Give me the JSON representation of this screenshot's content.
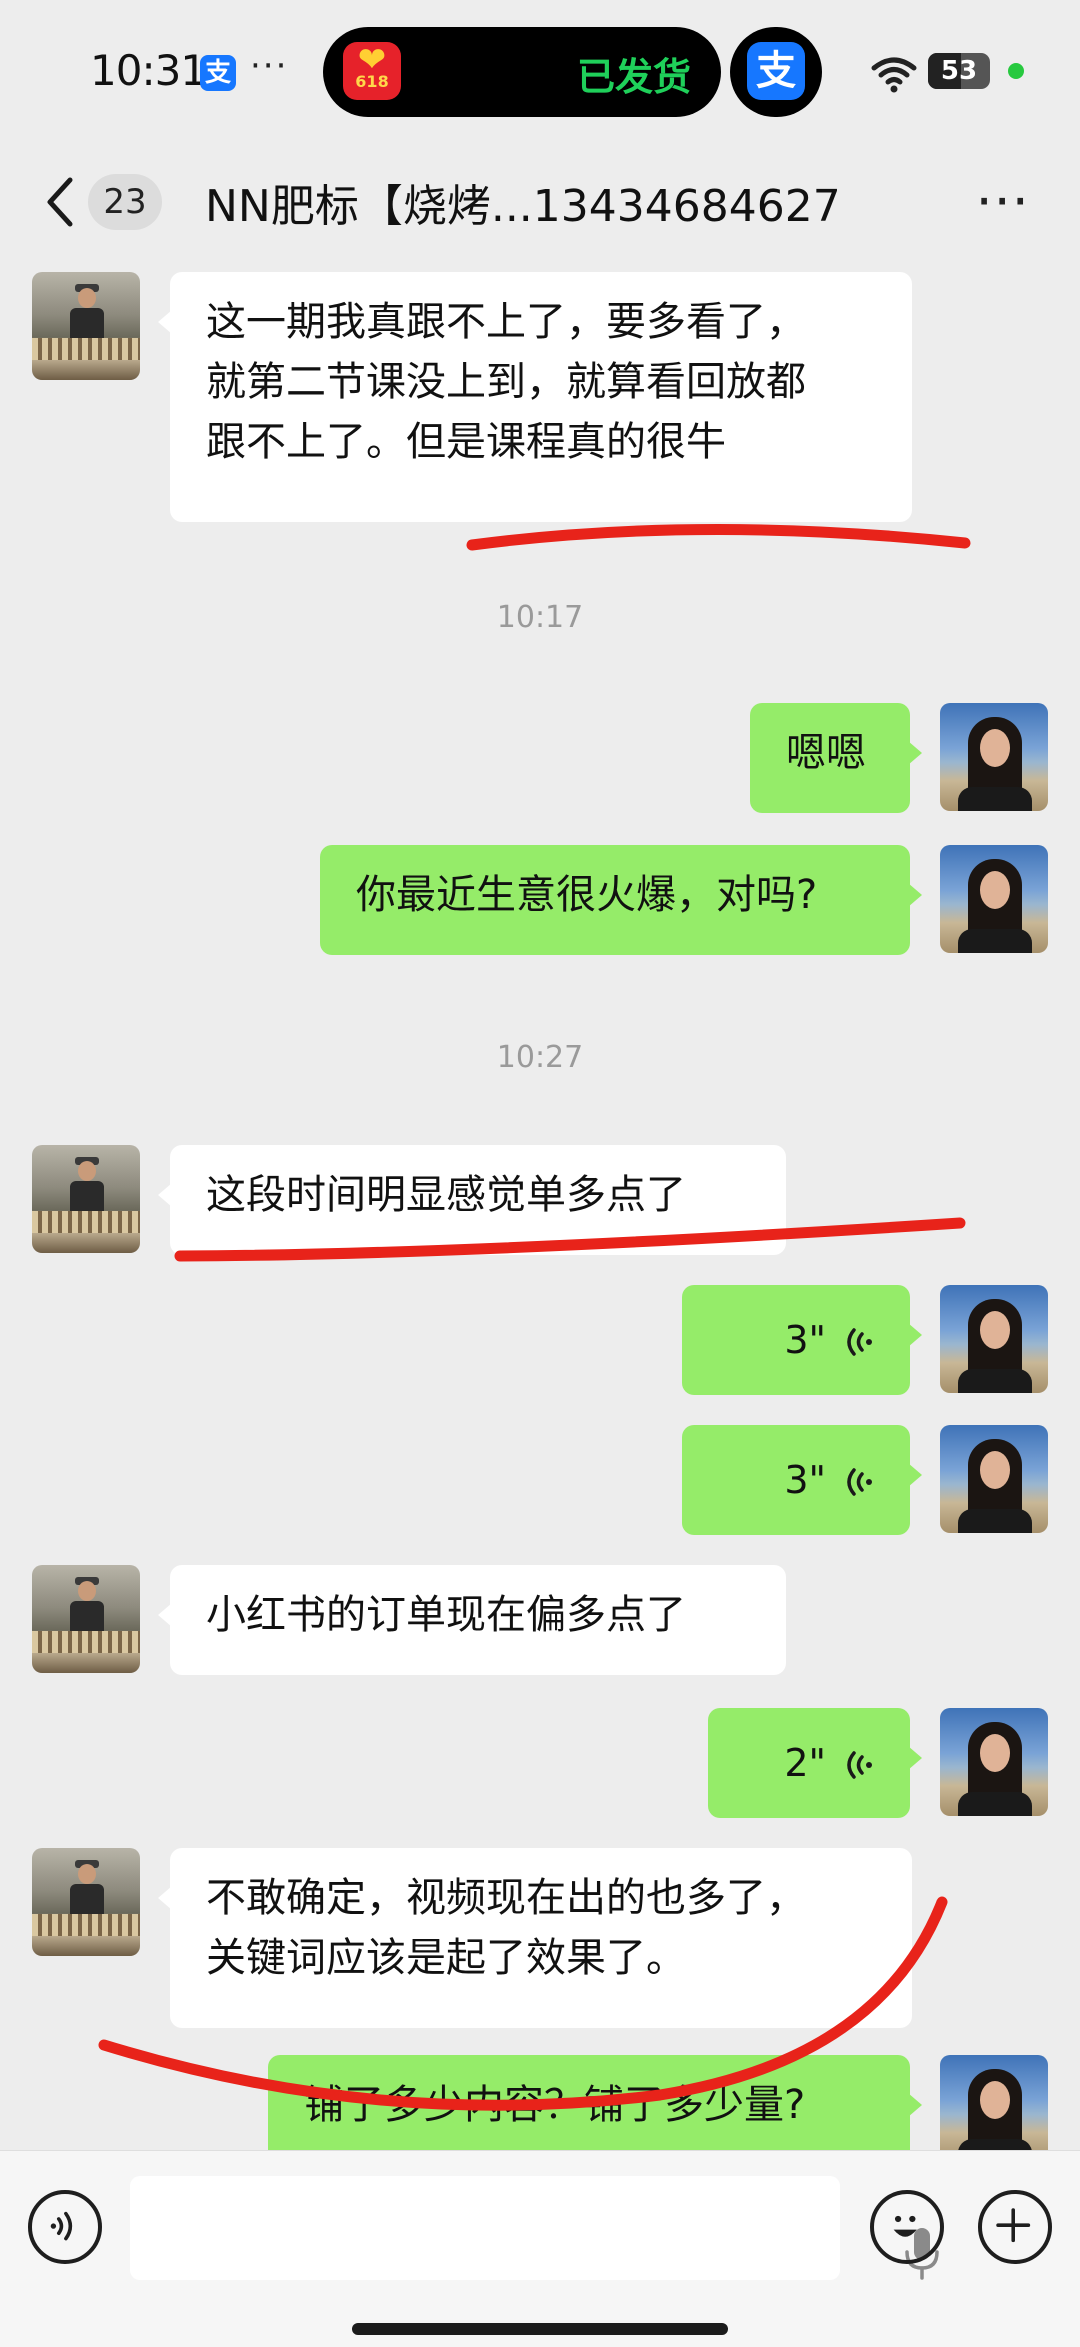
{
  "status_bar": {
    "time": "10:31",
    "alipay_glyph": "支",
    "more_glyph": "···",
    "island_text": "已发货",
    "island_app_label": "618",
    "battery": "53",
    "battery_fraction": 0.53
  },
  "nav": {
    "back_badge": "23",
    "title": "NN肥标【烧烤...13434684627",
    "more_glyph": "⋯"
  },
  "messages": [
    {
      "side": "in",
      "type": "text",
      "text": "这一期我真跟不上了，要多看了，\n就第二节课没上到，就算看回放都\n跟不上了。但是课程真的很牛"
    },
    {
      "type": "time",
      "text": "10:17"
    },
    {
      "side": "out",
      "type": "text",
      "text": "嗯嗯"
    },
    {
      "side": "out",
      "type": "text",
      "text": "你最近生意很火爆，对吗?"
    },
    {
      "type": "time",
      "text": "10:27"
    },
    {
      "side": "in",
      "type": "text",
      "text": "这段时间明显感觉单多点了"
    },
    {
      "side": "out",
      "type": "voice",
      "duration": "3\""
    },
    {
      "side": "out",
      "type": "voice",
      "duration": "3\""
    },
    {
      "side": "in",
      "type": "text",
      "text": "小红书的订单现在偏多点了"
    },
    {
      "side": "out",
      "type": "voice",
      "duration": "2\""
    },
    {
      "side": "in",
      "type": "text",
      "text": "不敢确定，视频现在出的也多了，\n关键词应该是起了效果了。"
    },
    {
      "side": "out",
      "type": "text",
      "text": "铺了多少内容？铺了多少量?"
    }
  ],
  "icons": {
    "back": "chevron-left-icon",
    "more": "more-dots-icon",
    "voice_toggle": "voice-toggle-icon",
    "mic": "mic-icon",
    "emoji": "emoji-icon",
    "plus": "plus-icon"
  },
  "colors": {
    "background": "#ededed",
    "bubble_in": "#ffffff",
    "bubble_out": "#95ec69",
    "annotation": "#e8231a",
    "island_text": "#1fd05a"
  }
}
